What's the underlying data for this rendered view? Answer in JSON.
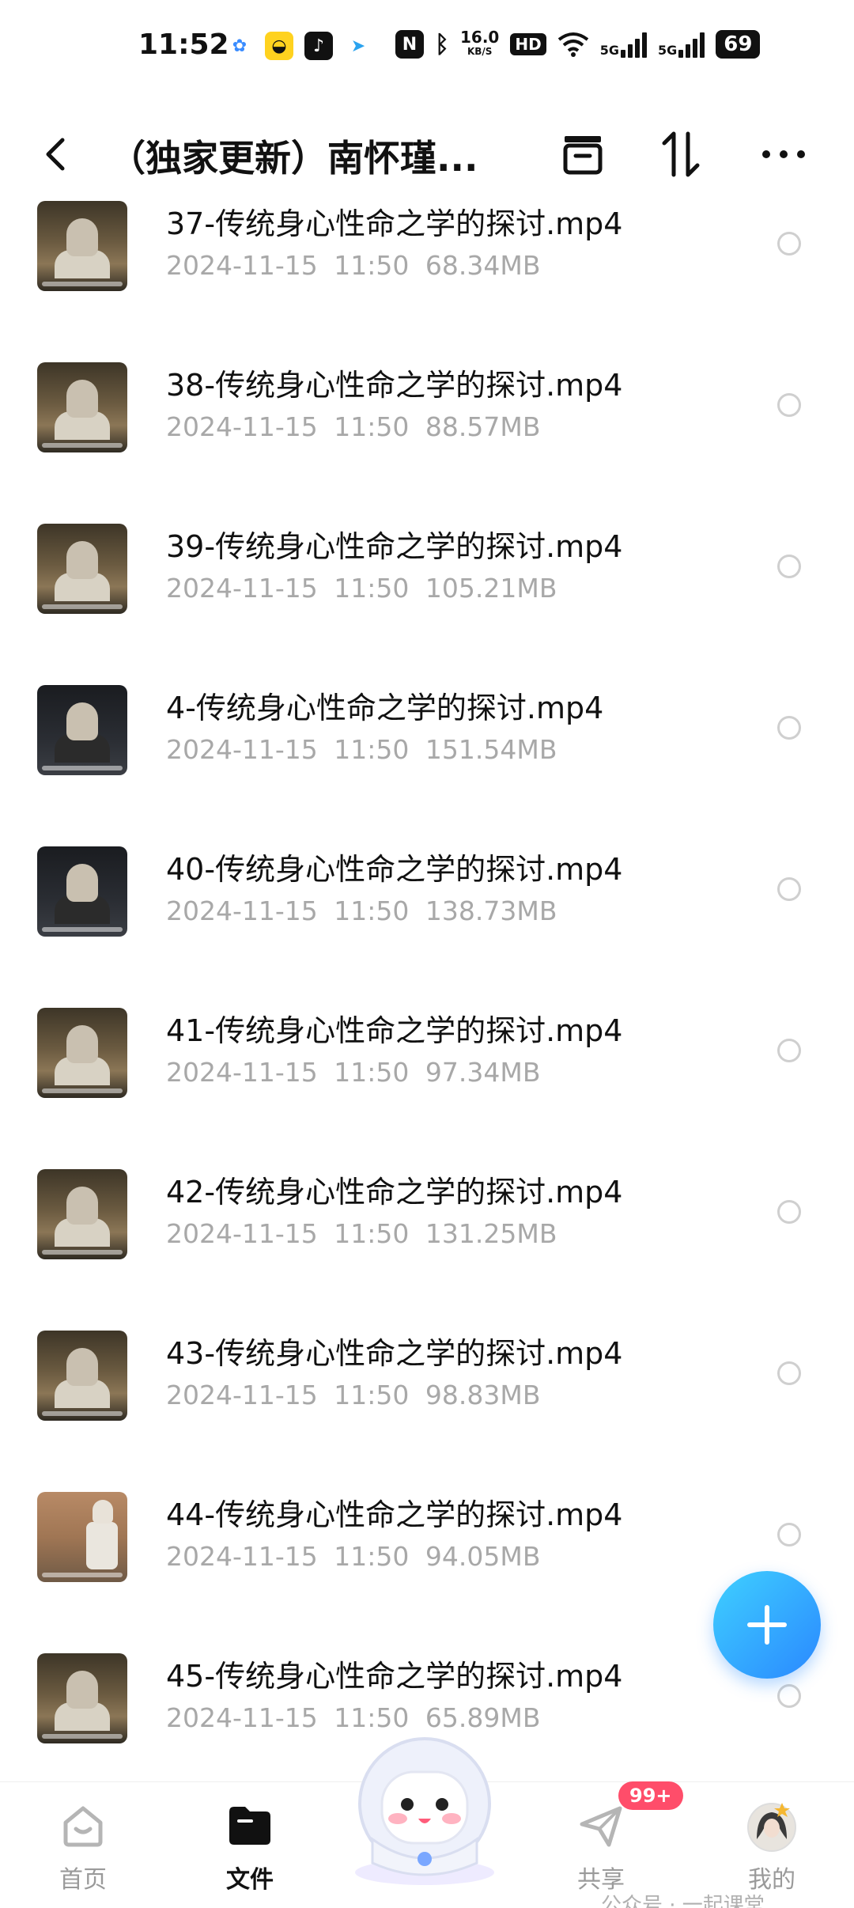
{
  "status_bar": {
    "time": "11:52",
    "net_speed": "16.0",
    "net_unit": "KB/S",
    "hd": "HD",
    "net_type_1": "5G",
    "net_type_2": "5G",
    "battery": "69"
  },
  "header": {
    "title": "（独家更新）南怀瑾..."
  },
  "files": [
    {
      "name": "37-传统身心性命之学的探讨.mp4",
      "date": "2024-11-15",
      "time": "11:50",
      "size": "68.34MB"
    },
    {
      "name": "38-传统身心性命之学的探讨.mp4",
      "date": "2024-11-15",
      "time": "11:50",
      "size": "88.57MB"
    },
    {
      "name": "39-传统身心性命之学的探讨.mp4",
      "date": "2024-11-15",
      "time": "11:50",
      "size": "105.21MB"
    },
    {
      "name": "4-传统身心性命之学的探讨.mp4",
      "date": "2024-11-15",
      "time": "11:50",
      "size": "151.54MB"
    },
    {
      "name": "40-传统身心性命之学的探讨.mp4",
      "date": "2024-11-15",
      "time": "11:50",
      "size": "138.73MB"
    },
    {
      "name": "41-传统身心性命之学的探讨.mp4",
      "date": "2024-11-15",
      "time": "11:50",
      "size": "97.34MB"
    },
    {
      "name": "42-传统身心性命之学的探讨.mp4",
      "date": "2024-11-15",
      "time": "11:50",
      "size": "131.25MB"
    },
    {
      "name": "43-传统身心性命之学的探讨.mp4",
      "date": "2024-11-15",
      "time": "11:50",
      "size": "98.83MB"
    },
    {
      "name": "44-传统身心性命之学的探讨.mp4",
      "date": "2024-11-15",
      "time": "11:50",
      "size": "94.05MB"
    },
    {
      "name": "45-传统身心性命之学的探讨.mp4",
      "date": "2024-11-15",
      "time": "11:50",
      "size": "65.89MB"
    }
  ],
  "nav": {
    "home": "首页",
    "files": "文件",
    "share": "共享",
    "share_badge": "99+",
    "mine": "我的"
  },
  "watermark": "公众号 · 一起课堂"
}
